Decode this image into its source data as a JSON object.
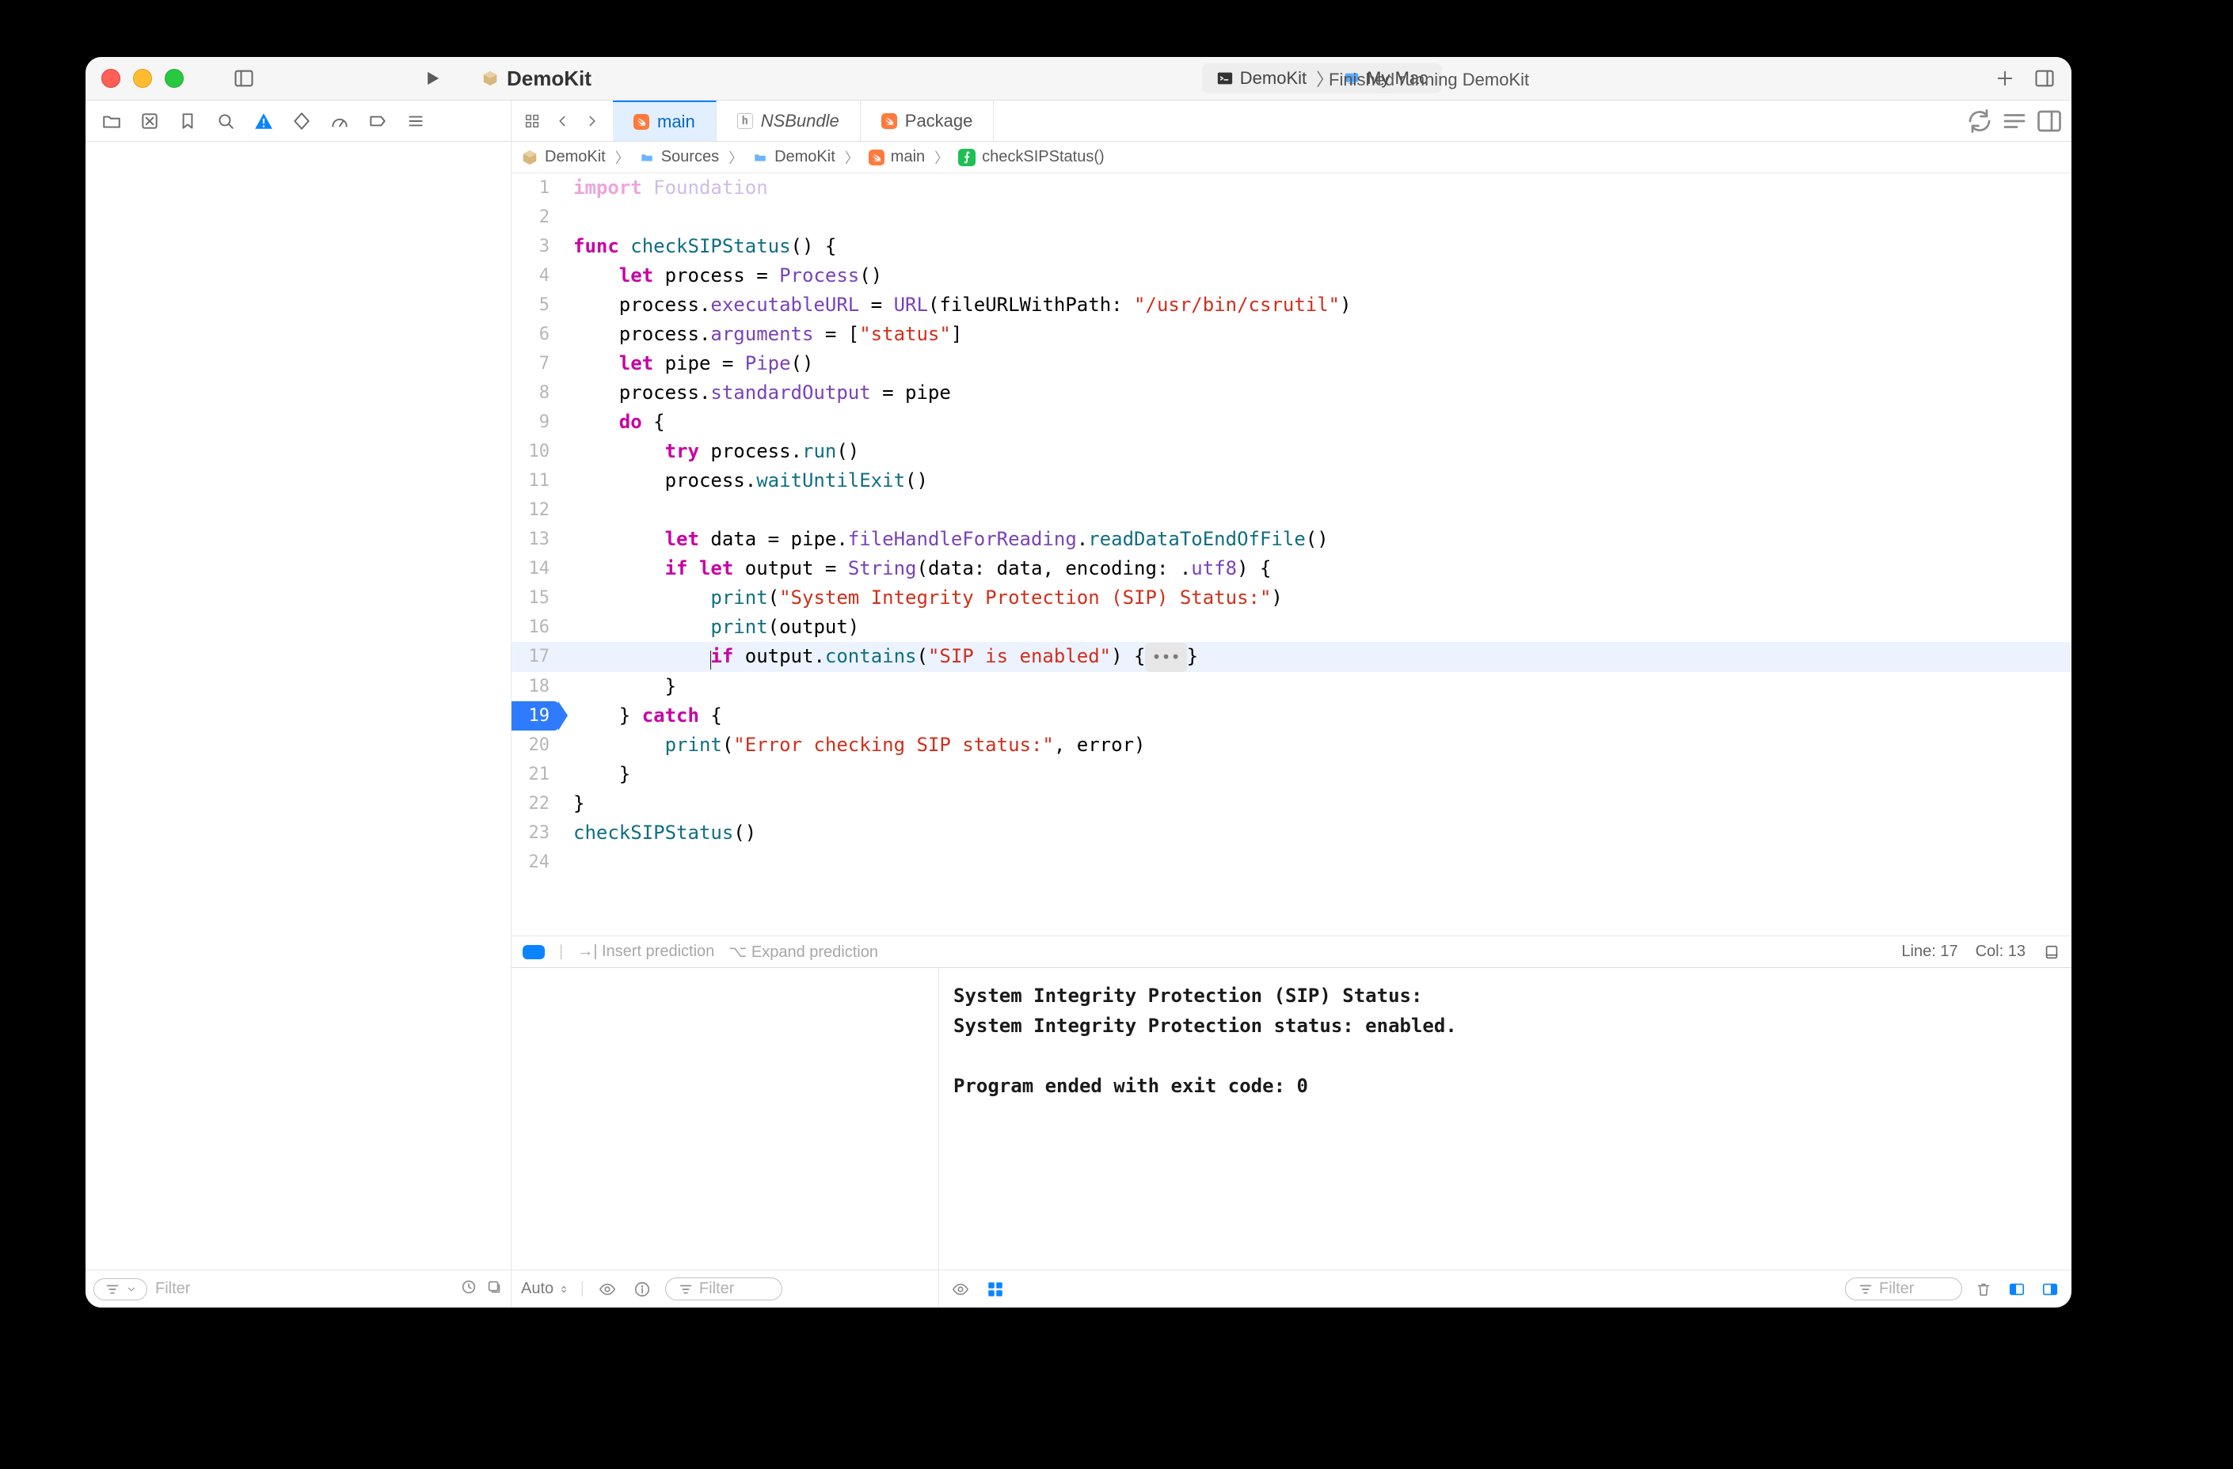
{
  "titlebar": {
    "scheme_name": "DemoKit",
    "target_scheme": "DemoKit",
    "target_device": "My Mac",
    "status": "Finished running DemoKit"
  },
  "tabs": {
    "main": "main",
    "nsbundle": "NSBundle",
    "package": "Package"
  },
  "breadcrumb": {
    "items": [
      "DemoKit",
      "Sources",
      "DemoKit",
      "main",
      "checkSIPStatus()"
    ]
  },
  "code": {
    "lines": [
      {
        "n": 1,
        "segs": [
          {
            "c": "tok-kw",
            "t": "import"
          },
          {
            "t": " "
          },
          {
            "c": "tok-type",
            "t": "Foundation"
          }
        ],
        "faded": true
      },
      {
        "n": 2,
        "segs": []
      },
      {
        "n": 3,
        "segs": [
          {
            "c": "tok-kw",
            "t": "func"
          },
          {
            "t": " "
          },
          {
            "c": "tok-def",
            "t": "checkSIPStatus"
          },
          {
            "t": "() {"
          }
        ]
      },
      {
        "n": 4,
        "segs": [
          {
            "t": "    "
          },
          {
            "c": "tok-kw",
            "t": "let"
          },
          {
            "t": " process = "
          },
          {
            "c": "tok-type",
            "t": "Process"
          },
          {
            "t": "()"
          }
        ]
      },
      {
        "n": 5,
        "segs": [
          {
            "t": "    process."
          },
          {
            "c": "tok-prop",
            "t": "executableURL"
          },
          {
            "t": " = "
          },
          {
            "c": "tok-type",
            "t": "URL"
          },
          {
            "t": "(fileURLWithPath: "
          },
          {
            "c": "tok-str",
            "t": "\"/usr/bin/csrutil\""
          },
          {
            "t": ")"
          }
        ]
      },
      {
        "n": 6,
        "segs": [
          {
            "t": "    process."
          },
          {
            "c": "tok-prop",
            "t": "arguments"
          },
          {
            "t": " = ["
          },
          {
            "c": "tok-str",
            "t": "\"status\""
          },
          {
            "t": "]"
          }
        ]
      },
      {
        "n": 7,
        "segs": [
          {
            "t": "    "
          },
          {
            "c": "tok-kw",
            "t": "let"
          },
          {
            "t": " pipe = "
          },
          {
            "c": "tok-type",
            "t": "Pipe"
          },
          {
            "t": "()"
          }
        ]
      },
      {
        "n": 8,
        "segs": [
          {
            "t": "    process."
          },
          {
            "c": "tok-prop",
            "t": "standardOutput"
          },
          {
            "t": " = pipe"
          }
        ]
      },
      {
        "n": 9,
        "segs": [
          {
            "t": "    "
          },
          {
            "c": "tok-kw",
            "t": "do"
          },
          {
            "t": " {"
          }
        ]
      },
      {
        "n": 10,
        "segs": [
          {
            "t": "        "
          },
          {
            "c": "tok-kw",
            "t": "try"
          },
          {
            "t": " process."
          },
          {
            "c": "tok-call",
            "t": "run"
          },
          {
            "t": "()"
          }
        ]
      },
      {
        "n": 11,
        "segs": [
          {
            "t": "        process."
          },
          {
            "c": "tok-call",
            "t": "waitUntilExit"
          },
          {
            "t": "()"
          }
        ]
      },
      {
        "n": 12,
        "segs": []
      },
      {
        "n": 13,
        "segs": [
          {
            "t": "        "
          },
          {
            "c": "tok-kw",
            "t": "let"
          },
          {
            "t": " data = pipe."
          },
          {
            "c": "tok-prop",
            "t": "fileHandleForReading"
          },
          {
            "t": "."
          },
          {
            "c": "tok-call",
            "t": "readDataToEndOfFile"
          },
          {
            "t": "()"
          }
        ]
      },
      {
        "n": 14,
        "segs": [
          {
            "t": "        "
          },
          {
            "c": "tok-kw",
            "t": "if"
          },
          {
            "t": " "
          },
          {
            "c": "tok-kw",
            "t": "let"
          },
          {
            "t": " output = "
          },
          {
            "c": "tok-type",
            "t": "String"
          },
          {
            "t": "(data: data, encoding: ."
          },
          {
            "c": "tok-prop",
            "t": "utf8"
          },
          {
            "t": ") {"
          }
        ]
      },
      {
        "n": 15,
        "segs": [
          {
            "t": "            "
          },
          {
            "c": "tok-call",
            "t": "print"
          },
          {
            "t": "("
          },
          {
            "c": "tok-str",
            "t": "\"System Integrity Protection (SIP) Status:\""
          },
          {
            "t": ")"
          }
        ]
      },
      {
        "n": 16,
        "segs": [
          {
            "t": "            "
          },
          {
            "c": "tok-call",
            "t": "print"
          },
          {
            "t": "(output)"
          }
        ]
      },
      {
        "n": 17,
        "hl": true,
        "segs": [
          {
            "t": "            "
          },
          {
            "c": "tok-kw",
            "t": "if",
            "caret": true
          },
          {
            "t": " output."
          },
          {
            "c": "tok-call",
            "t": "contains"
          },
          {
            "t": "("
          },
          {
            "c": "tok-str",
            "t": "\"SIP is enabled\""
          },
          {
            "t": ") {"
          },
          {
            "fold": true
          },
          {
            "t": "}"
          }
        ]
      },
      {
        "n": 18,
        "segs": [
          {
            "t": "        }"
          }
        ]
      },
      {
        "n": 19,
        "bp": true,
        "segs": [
          {
            "t": "    } "
          },
          {
            "c": "tok-kw",
            "t": "catch"
          },
          {
            "t": " {"
          }
        ]
      },
      {
        "n": 20,
        "segs": [
          {
            "t": "        "
          },
          {
            "c": "tok-call",
            "t": "print"
          },
          {
            "t": "("
          },
          {
            "c": "tok-str",
            "t": "\"Error checking SIP status:\""
          },
          {
            "t": ", error)"
          }
        ]
      },
      {
        "n": 21,
        "segs": [
          {
            "t": "    }"
          }
        ]
      },
      {
        "n": 22,
        "segs": [
          {
            "t": "}"
          }
        ]
      },
      {
        "n": 23,
        "segs": [
          {
            "c": "tok-call",
            "t": "checkSIPStatus"
          },
          {
            "t": "()"
          }
        ]
      },
      {
        "n": 24,
        "segs": []
      }
    ],
    "faded_opacity": "0.35"
  },
  "prediction_bar": {
    "insert": "Insert prediction",
    "insert_key": "→|",
    "expand": "Expand prediction",
    "expand_key": "⌥",
    "line": "Line:",
    "line_val": "17",
    "col": "Col:",
    "col_val": "13"
  },
  "console": {
    "lines": [
      "System Integrity Protection (SIP) Status:",
      "System Integrity Protection status: enabled.",
      "",
      "Program ended with exit code: 0"
    ]
  },
  "debug_footer": {
    "left_label": "Auto",
    "filter_ph": "Filter"
  },
  "nav_filter": {
    "placeholder": "Filter"
  }
}
